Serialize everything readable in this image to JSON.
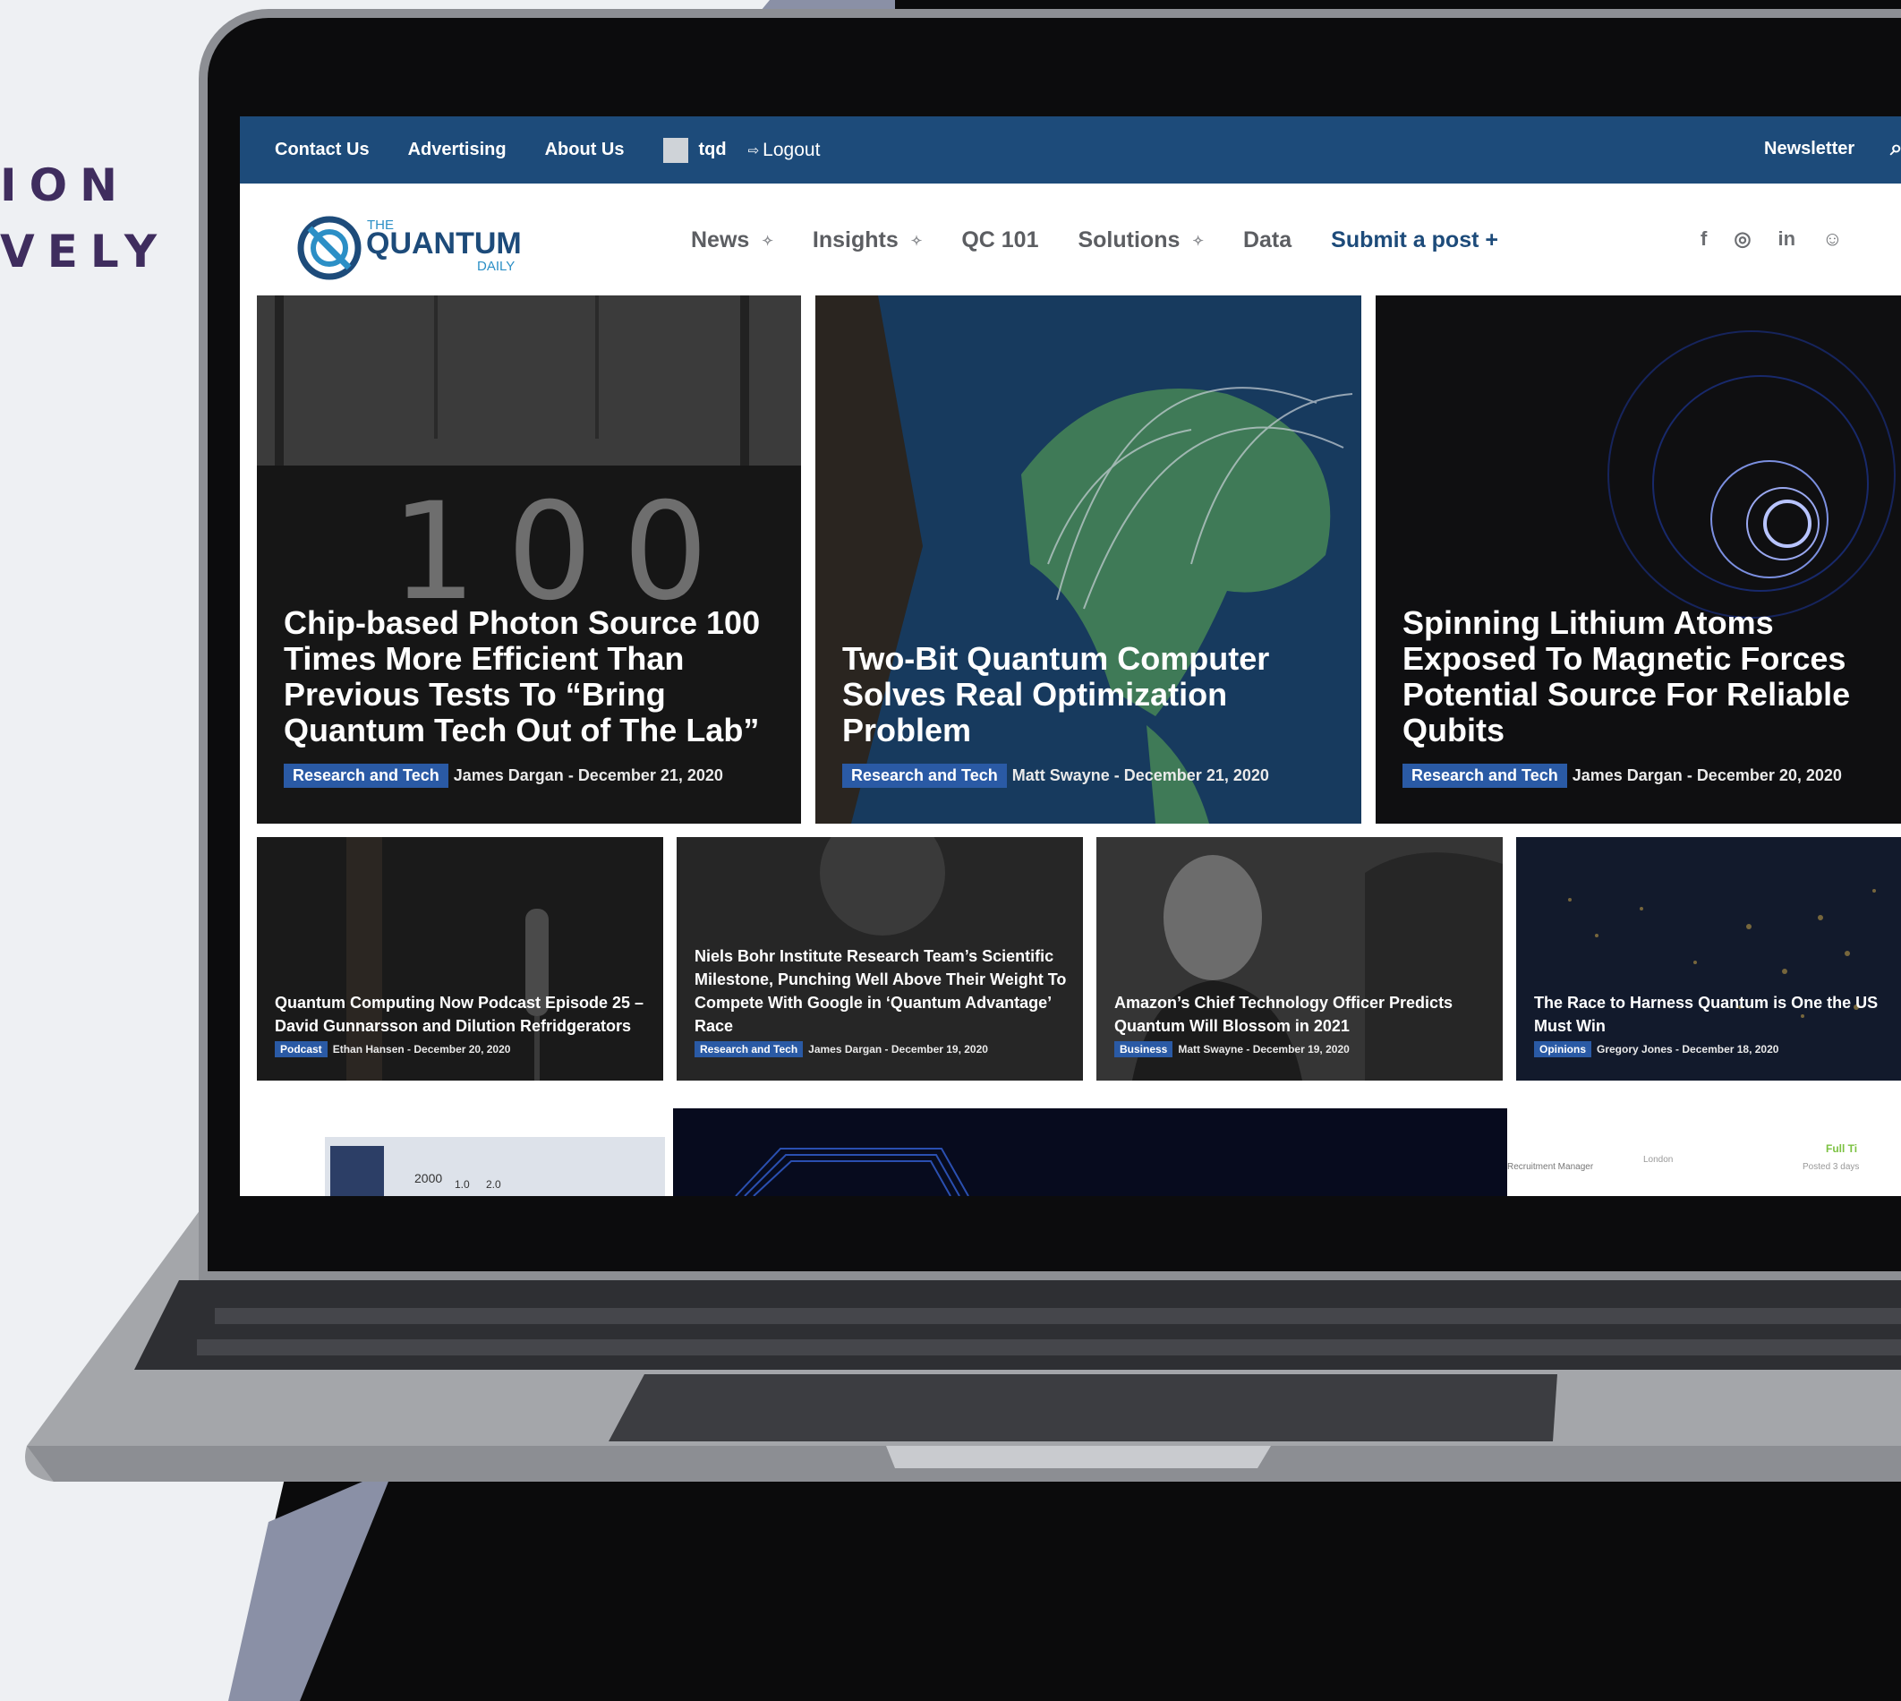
{
  "side_text": [
    "ION",
    "VELY"
  ],
  "topbar": {
    "links": [
      "Contact Us",
      "Advertising",
      "About Us"
    ],
    "user": "tqd",
    "logout": "Logout",
    "newsletter": "Newsletter"
  },
  "logo": {
    "the": "THE",
    "name": "QUANTUM",
    "daily": "DAILY"
  },
  "nav": {
    "news": "News",
    "insights": "Insights",
    "qc101": "QC 101",
    "solutions": "Solutions",
    "data": "Data",
    "submit": "Submit a post +"
  },
  "social": [
    "f",
    "◎",
    "in",
    "☺"
  ],
  "featured": [
    {
      "title": "Chip-based Photon Source 100 Times More Efficient Than Previous Tests To “Bring Quantum Tech Out of The Lab”",
      "tag": "Research and Tech",
      "author": "James Dargan",
      "date": "December 21, 2020",
      "image_text": "100"
    },
    {
      "title": "Two-Bit Quantum Computer Solves Real Optimization Problem",
      "tag": "Research and Tech",
      "author": "Matt Swayne",
      "date": "December 21, 2020"
    },
    {
      "title": "Spinning Lithium Atoms Exposed To Magnetic Forces Potential Source For Reliable Qubits",
      "tag": "Research and Tech",
      "author": "James Dargan",
      "date": "December 20, 2020"
    }
  ],
  "secondary": [
    {
      "title": "Quantum Computing Now Podcast Episode 25 – David Gunnarsson and Dilution Refridgerators",
      "tag": "Podcast",
      "author": "Ethan Hansen",
      "date": "December 20, 2020"
    },
    {
      "title": "Niels Bohr Institute Research Team’s Scientific Milestone, Punching Well Above Their Weight To Compete With Google in ‘Quantum Advantage’ Race",
      "tag": "Research and Tech",
      "author": "James Dargan",
      "date": "December 19, 2020"
    },
    {
      "title": "Amazon’s Chief Technology Officer Predicts Quantum Will Blossom in 2021",
      "tag": "Business",
      "author": "Matt Swayne",
      "date": "December 19, 2020"
    },
    {
      "title": "The Race to Harness Quantum is One the US Must Win",
      "tag": "Opinions",
      "author": "Gregory Jones",
      "date": "December 18, 2020"
    }
  ],
  "bottom_strip": {
    "ad_numbers": [
      "2000",
      "1.0",
      "2.0"
    ],
    "job_title": "Recruitment Manager",
    "job_location": "London",
    "job_type": "Full Ti",
    "job_posted": "Posted 3 days"
  }
}
